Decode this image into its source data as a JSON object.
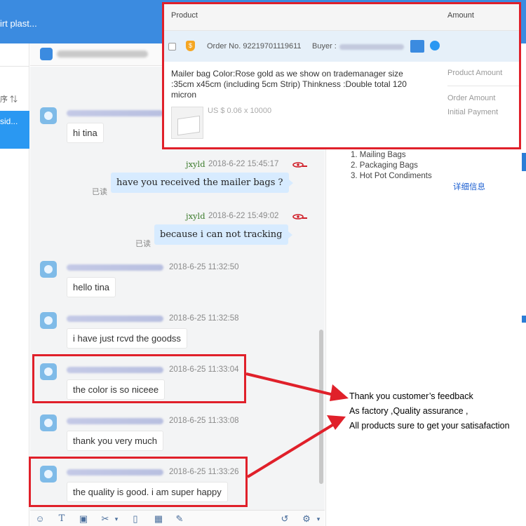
{
  "app": {
    "title_fragment": "irt plast..."
  },
  "sidebar": {
    "sort_label": "序 ⇅",
    "active_conversation_label": "sid..."
  },
  "order": {
    "header_product": "Product",
    "header_amount": "Amount",
    "order_number": "Order No. 92219701119611",
    "buyer_label": "Buyer :",
    "description": "Mailer bag Color:Rose gold as we show on trademanager size :35cm x45cm (including 5cm Strip) Thinkness :Double total 120 micron",
    "price": "US $ 0.06 x 10000",
    "product_amount_label": "Product Amount",
    "order_amount_label": "Order Amount",
    "initial_payment_label": "Initial Payment"
  },
  "categories": [
    "1. Mailing Bags",
    "2. Packaging Bags",
    "3. Hot Pot Condiments"
  ],
  "detail_link": "详细信息",
  "messages": [
    {
      "text": "hi tina"
    },
    {
      "sender": "jxyld",
      "time": "2018-6-22 15:45:17",
      "text": "have you received the mailer bags ?",
      "read": "已读"
    },
    {
      "sender": "jxyld",
      "time": "2018-6-22 15:49:02",
      "text": "because i can not tracking",
      "read": "已读"
    },
    {
      "time": "2018-6-25 11:32:50",
      "text": "hello tina"
    },
    {
      "time": "2018-6-25 11:32:58",
      "text": "i have just rcvd the goodss"
    },
    {
      "time": "2018-6-25 11:33:04",
      "text": "the color is  so niceee"
    },
    {
      "time": "2018-6-25 11:33:08",
      "text": "thank you very much"
    },
    {
      "time": "2018-6-25 11:33:26",
      "text": "the quality is good. i am super happy"
    }
  ],
  "annotation": [
    "Thank you customer’s feedback",
    "As factory ,Quality assurance ,",
    "All products sure to get your satisafaction"
  ],
  "colors": {
    "highlight_red": "#e0202a",
    "accent_blue": "#3b8be0",
    "outgoing_bubble": "#d7ebff"
  }
}
